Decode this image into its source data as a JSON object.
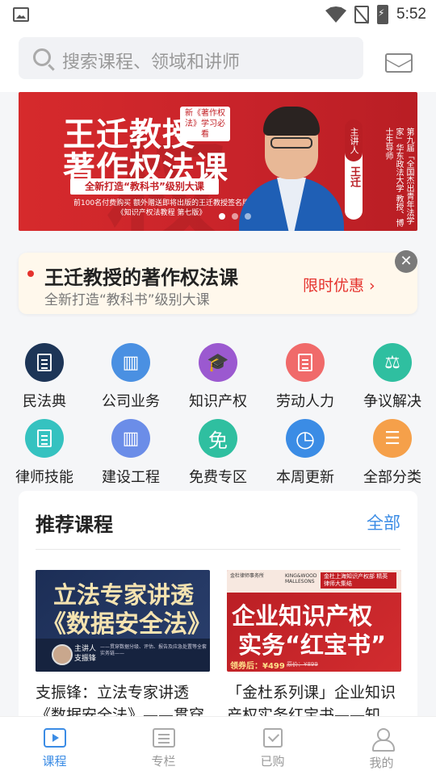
{
  "status_bar": {
    "time": "5:52",
    "icons": [
      "image-icon",
      "wifi-icon",
      "no-sim-icon",
      "battery-charging-icon"
    ]
  },
  "search": {
    "placeholder": "搜索课程、领域和讲师",
    "icon": "search-icon"
  },
  "header": {
    "mail_icon": "mail-icon"
  },
  "banner": {
    "line1": "王迁教授",
    "line2": "著作权法课",
    "tag": "新《著作权法》学习必看",
    "pill": "全新打造“教科书”级别大课",
    "note": "前100名付费购买 额外赠送即将出版的王迁教授签名版《知识产权法教程 第七版》",
    "speaker_role": "主讲人",
    "speaker_name": "王迁",
    "speaker_desc": "第九届「全国杰出青年法学家」华东政法大学 教授、博士生导师",
    "dots": 3,
    "active_dot": 0
  },
  "promo": {
    "title": "王迁教授的著作权法课",
    "subtitle": "全新打造“教科书”级别大课",
    "cta": "限时优惠 ›",
    "close_icon": "close-icon"
  },
  "categories": [
    {
      "label": "民法典",
      "icon": "book-icon",
      "color": "#1d3557"
    },
    {
      "label": "公司业务",
      "icon": "building-icon",
      "color": "#4a90e2"
    },
    {
      "label": "知识产权",
      "icon": "graduation-cap-icon",
      "color": "#9b59d0"
    },
    {
      "label": "劳动人力",
      "icon": "document-copy-icon",
      "color": "#f06a6a"
    },
    {
      "label": "争议解决",
      "icon": "scale-icon",
      "color": "#2fbfa0"
    },
    {
      "label": "律师技能",
      "icon": "certificate-icon",
      "color": "#35c2c0"
    },
    {
      "label": "建设工程",
      "icon": "office-building-icon",
      "color": "#6b8de8"
    },
    {
      "label": "免费专区",
      "icon": "free-icon",
      "color": "#2fbfa0"
    },
    {
      "label": "本周更新",
      "icon": "clock-icon",
      "color": "#3b8ce5"
    },
    {
      "label": "全部分类",
      "icon": "list-icon",
      "color": "#f5a04a"
    }
  ],
  "recommended": {
    "title": "推荐课程",
    "all_label": "全部",
    "courses": [
      {
        "title": "支振锋：立法专家讲透《数据安全法》——贯穿",
        "thumb_line1": "立法专家讲透",
        "thumb_line2": "《数据安全法》",
        "thumb_speaker": "主讲人 支振锋",
        "thumb_desc": "——贯穿数据分级、评估、报告及应急处置等全套实务链——"
      },
      {
        "title": "「金杜系列课」企业知识产权实务红宝书——知",
        "thumb_line1": "企业知识产权",
        "thumb_line2": "实务“红宝书”",
        "thumb_firm": "金杜律师事务所",
        "thumb_logo": "KING&WOOD MALLESONS",
        "thumb_tag": "金杜上海知识产权部 精英律师大集结",
        "thumb_price": "领券后：¥499",
        "thumb_orig": "原价：¥899"
      }
    ]
  },
  "bottom_nav": [
    {
      "label": "课程",
      "icon": "video-icon",
      "active": true
    },
    {
      "label": "专栏",
      "icon": "column-icon",
      "active": false
    },
    {
      "label": "已购",
      "icon": "purchased-icon",
      "active": false
    },
    {
      "label": "我的",
      "icon": "profile-icon",
      "active": false
    }
  ]
}
